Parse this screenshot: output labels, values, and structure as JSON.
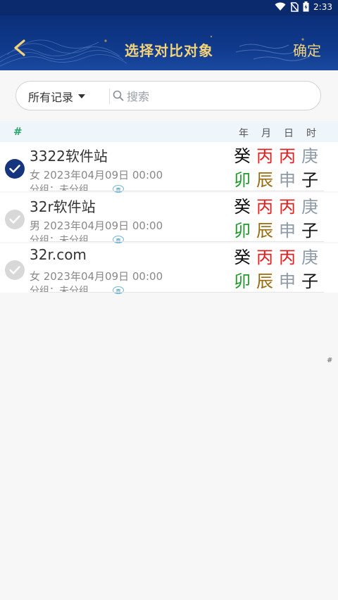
{
  "status_bar": {
    "time": "2:33"
  },
  "header": {
    "title": "选择对比对象",
    "confirm_label": "确定"
  },
  "search": {
    "filter_label": "所有记录",
    "placeholder": "搜索"
  },
  "columns": {
    "hash": "#",
    "labels": [
      "年",
      "月",
      "日",
      "时"
    ]
  },
  "records": [
    {
      "name": "3322软件站",
      "meta": "女 2023年04月09日 00:00",
      "group": "分组：未分组",
      "badge": "真",
      "checked": true,
      "top_pillars": [
        {
          "char": "癸",
          "color": "black"
        },
        {
          "char": "丙",
          "color": "red"
        },
        {
          "char": "丙",
          "color": "red"
        },
        {
          "char": "庚",
          "color": "gray"
        }
      ],
      "bottom_pillars": [
        {
          "char": "卯",
          "color": "green"
        },
        {
          "char": "辰",
          "color": "brown"
        },
        {
          "char": "申",
          "color": "gray"
        },
        {
          "char": "子",
          "color": "black"
        }
      ]
    },
    {
      "name": "32r软件站",
      "meta": "男 2023年04月09日 00:00",
      "group": "分组：未分组",
      "badge": "真",
      "checked": false,
      "top_pillars": [
        {
          "char": "癸",
          "color": "black"
        },
        {
          "char": "丙",
          "color": "red"
        },
        {
          "char": "丙",
          "color": "red"
        },
        {
          "char": "庚",
          "color": "gray"
        }
      ],
      "bottom_pillars": [
        {
          "char": "卯",
          "color": "green"
        },
        {
          "char": "辰",
          "color": "brown"
        },
        {
          "char": "申",
          "color": "gray"
        },
        {
          "char": "子",
          "color": "black"
        }
      ]
    },
    {
      "name": "32r.com",
      "meta": "女 2023年04月09日 00:00",
      "group": "分组：未分组",
      "badge": "真",
      "checked": false,
      "top_pillars": [
        {
          "char": "癸",
          "color": "black"
        },
        {
          "char": "丙",
          "color": "red"
        },
        {
          "char": "丙",
          "color": "red"
        },
        {
          "char": "庚",
          "color": "gray"
        }
      ],
      "bottom_pillars": [
        {
          "char": "卯",
          "color": "green"
        },
        {
          "char": "辰",
          "color": "brown"
        },
        {
          "char": "申",
          "color": "gray"
        },
        {
          "char": "子",
          "color": "black"
        }
      ]
    }
  ],
  "index_bar": {
    "label": "#"
  },
  "colors": {
    "header_bg": "#0b2f7a",
    "accent_gold": "#f3d27a",
    "checked": "#17357d",
    "red": "#e02020",
    "green": "#1f9a2a",
    "brown": "#9a6a0c",
    "gray": "#8e9aa8"
  }
}
